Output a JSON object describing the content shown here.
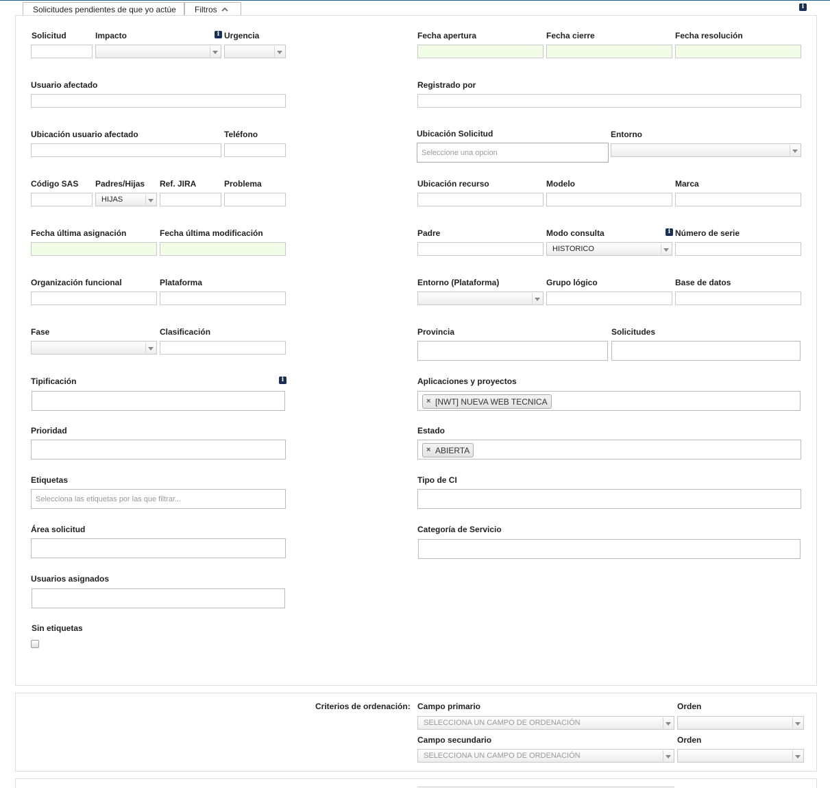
{
  "tabs": {
    "pending": "Solicitudes pendientes de que yo actúe",
    "filters": "Filtros"
  },
  "fields": {
    "solicitud": "Solicitud",
    "impacto": "Impacto",
    "urgencia": "Urgencia",
    "fecha_apertura": "Fecha apertura",
    "fecha_cierre": "Fecha cierre",
    "fecha_resolucion": "Fecha resolución",
    "usuario_afectado": "Usuario afectado",
    "registrado_por": "Registrado por",
    "ubicacion_usuario": "Ubicación usuario afectado",
    "telefono": "Teléfono",
    "ubicacion_solicitud": "Ubicación Solicitud",
    "ubicacion_solicitud_placeholder": "Seleccione una opcion",
    "entorno": "Entorno",
    "codigo_sas": "Código SAS",
    "padres_hijas": "Padres/Hijas",
    "padres_hijas_value": "HIJAS",
    "ref_jira": "Ref. JIRA",
    "problema": "Problema",
    "ubicacion_recurso": "Ubicación recurso",
    "modelo": "Modelo",
    "marca": "Marca",
    "fecha_ultima_asignacion": "Fecha última asignación",
    "fecha_ultima_modificacion": "Fecha última modificación",
    "padre": "Padre",
    "modo_consulta": "Modo consulta",
    "modo_consulta_value": "HISTORICO",
    "numero_serie": "Número de serie",
    "organizacion_funcional": "Organización funcional",
    "plataforma": "Plataforma",
    "entorno_plataforma": "Entorno (Plataforma)",
    "grupo_logico": "Grupo lógico",
    "base_datos": "Base de datos",
    "fase": "Fase",
    "clasificacion": "Clasificación",
    "provincia": "Provincia",
    "solicitudes": "Solicitudes",
    "tipificacion": "Tipificación",
    "aplicaciones": "Aplicaciones y proyectos",
    "aplicaciones_tag": "[NWT] NUEVA WEB TECNICA",
    "prioridad": "Prioridad",
    "estado": "Estado",
    "estado_tag": "ABIERTA",
    "etiquetas": "Etiquetas",
    "etiquetas_placeholder": "Selecciona las etiquetas por las que filtrar...",
    "tipo_ci": "Tipo de CI",
    "area_solicitud": "Área solicitud",
    "categoria_servicio": "Categoría de Servicio",
    "usuarios_asignados": "Usuarios asignados",
    "sin_etiquetas": "Sin etiquetas"
  },
  "sort": {
    "criterios": "Criterios de ordenación:",
    "campo_primario": "Campo primario",
    "campo_secundario": "Campo secundario",
    "orden": "Orden",
    "placeholder": "SELECCIONA UN CAMPO DE ORDENACIÓN"
  },
  "icons": {
    "info": "i",
    "chevron_up": "chevron-up-icon",
    "remove": "×"
  },
  "colors": {
    "accent_line": "#1f5f8f",
    "date_field_bg": "#f2fde8",
    "info_icon": "#1a2f55"
  }
}
